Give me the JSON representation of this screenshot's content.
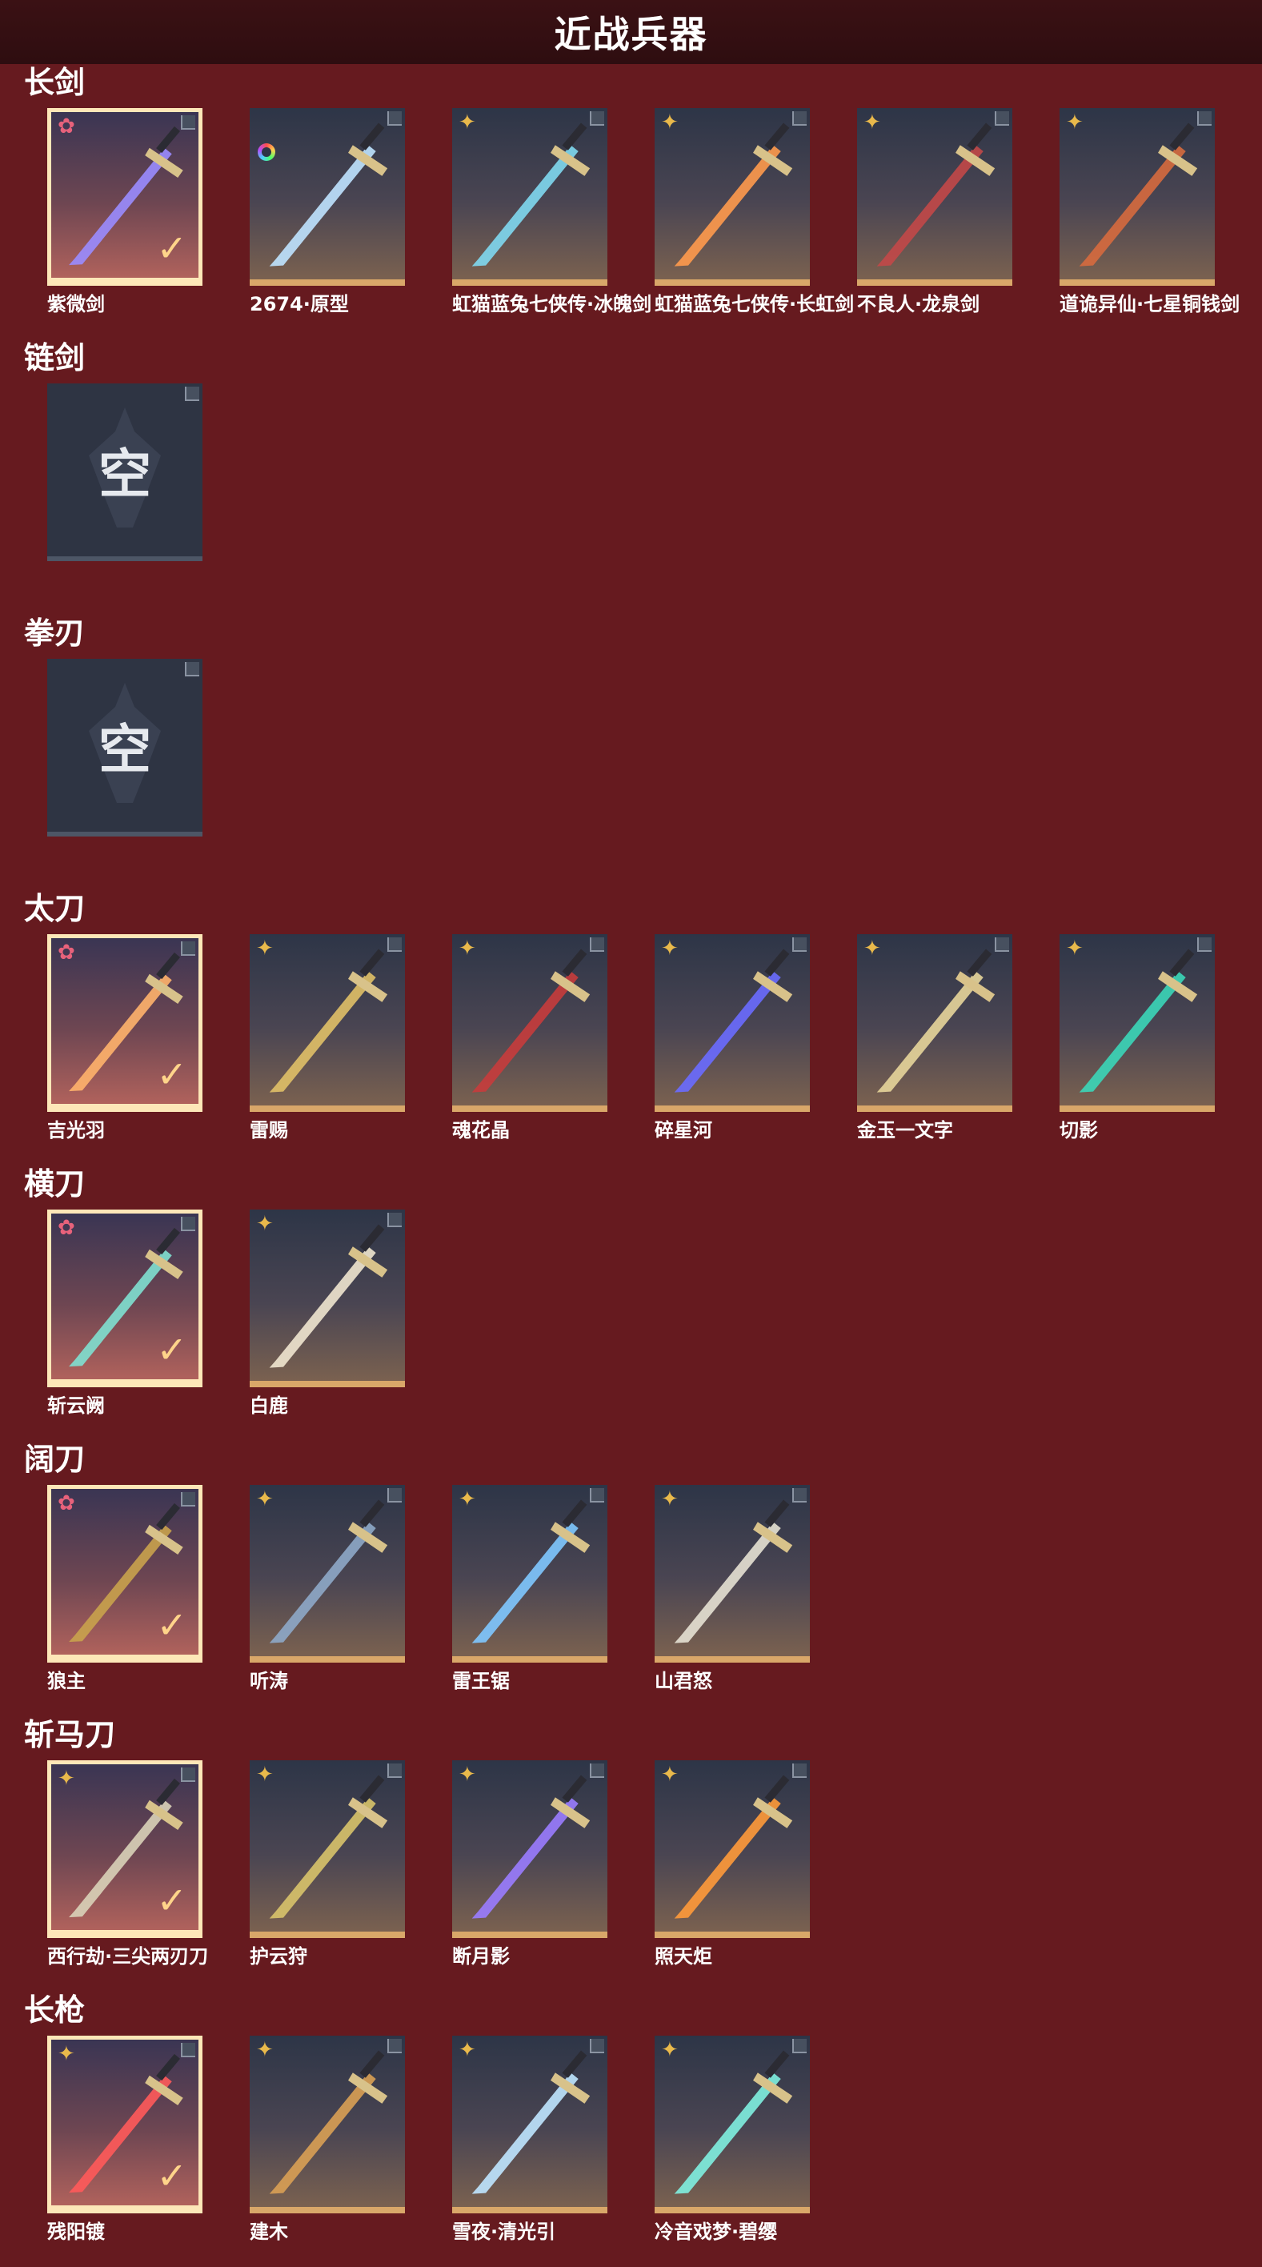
{
  "page_title": "近战兵器",
  "empty_label": "空",
  "check_mark": "✓",
  "sections": [
    {
      "title": "长剑",
      "items": [
        {
          "name": "紫微剑",
          "badge": "red",
          "selected": true,
          "hue": "#9a8cff"
        },
        {
          "name": "2674·原型",
          "badge": "ring",
          "selected": false,
          "hue": "#bfe3ff"
        },
        {
          "name": "虹猫蓝兔七侠传·冰魄剑",
          "badge": "gold",
          "selected": false,
          "hue": "#7fd8f0"
        },
        {
          "name": "虹猫蓝兔七侠传·长虹剑",
          "badge": "gold",
          "selected": false,
          "hue": "#ff9a4d"
        },
        {
          "name": "不良人·龙泉剑",
          "badge": "gold",
          "selected": false,
          "hue": "#c24848"
        },
        {
          "name": "道诡异仙·七星铜钱剑",
          "badge": "gold",
          "selected": false,
          "hue": "#d66a3e"
        }
      ]
    },
    {
      "title": "链剑",
      "items": [
        {
          "name": "",
          "badge": "none",
          "selected": false,
          "empty": true
        }
      ]
    },
    {
      "title": "拳刃",
      "items": [
        {
          "name": "",
          "badge": "none",
          "selected": false,
          "empty": true
        }
      ]
    },
    {
      "title": "太刀",
      "items": [
        {
          "name": "吉光羽",
          "badge": "red",
          "selected": true,
          "hue": "#ffb36b"
        },
        {
          "name": "雷赐",
          "badge": "gold",
          "selected": false,
          "hue": "#e0c067"
        },
        {
          "name": "魂花晶",
          "badge": "gold",
          "selected": false,
          "hue": "#c63c3c"
        },
        {
          "name": "碎星河",
          "badge": "gold",
          "selected": false,
          "hue": "#6a6cff"
        },
        {
          "name": "金玉一文字",
          "badge": "gold",
          "selected": false,
          "hue": "#e7d59a"
        },
        {
          "name": "切影",
          "badge": "gold",
          "selected": false,
          "hue": "#3bd6b8"
        }
      ]
    },
    {
      "title": "横刀",
      "items": [
        {
          "name": "斩云阙",
          "badge": "red",
          "selected": true,
          "hue": "#7fe0d0"
        },
        {
          "name": "白鹿",
          "badge": "gold",
          "selected": false,
          "hue": "#efe6cf"
        }
      ]
    },
    {
      "title": "阔刀",
      "items": [
        {
          "name": "狼主",
          "badge": "red",
          "selected": true,
          "hue": "#c9a24c"
        },
        {
          "name": "听涛",
          "badge": "gold",
          "selected": false,
          "hue": "#8ea8c8"
        },
        {
          "name": "雷王锯",
          "badge": "gold",
          "selected": false,
          "hue": "#7fc8ff"
        },
        {
          "name": "山君怒",
          "badge": "gold",
          "selected": false,
          "hue": "#e6e1d3"
        }
      ]
    },
    {
      "title": "斩马刀",
      "items": [
        {
          "name": "西行劫·三尖两刃刀",
          "badge": "gold",
          "selected": true,
          "hue": "#d9d1b8"
        },
        {
          "name": "护云狩",
          "badge": "gold",
          "selected": false,
          "hue": "#d8c36a"
        },
        {
          "name": "断月影",
          "badge": "gold",
          "selected": false,
          "hue": "#9a7cff"
        },
        {
          "name": "照天炬",
          "badge": "gold",
          "selected": false,
          "hue": "#ff9a3a"
        }
      ]
    },
    {
      "title": "长枪",
      "items": [
        {
          "name": "残阳镀",
          "badge": "gold",
          "selected": true,
          "hue": "#ff5a5a"
        },
        {
          "name": "建木",
          "badge": "gold",
          "selected": false,
          "hue": "#d9a054"
        },
        {
          "name": "雪夜·清光引",
          "badge": "gold",
          "selected": false,
          "hue": "#bfe6ff"
        },
        {
          "name": "冷音戏梦·碧缨",
          "badge": "gold",
          "selected": false,
          "hue": "#7ff0e0"
        }
      ]
    }
  ]
}
